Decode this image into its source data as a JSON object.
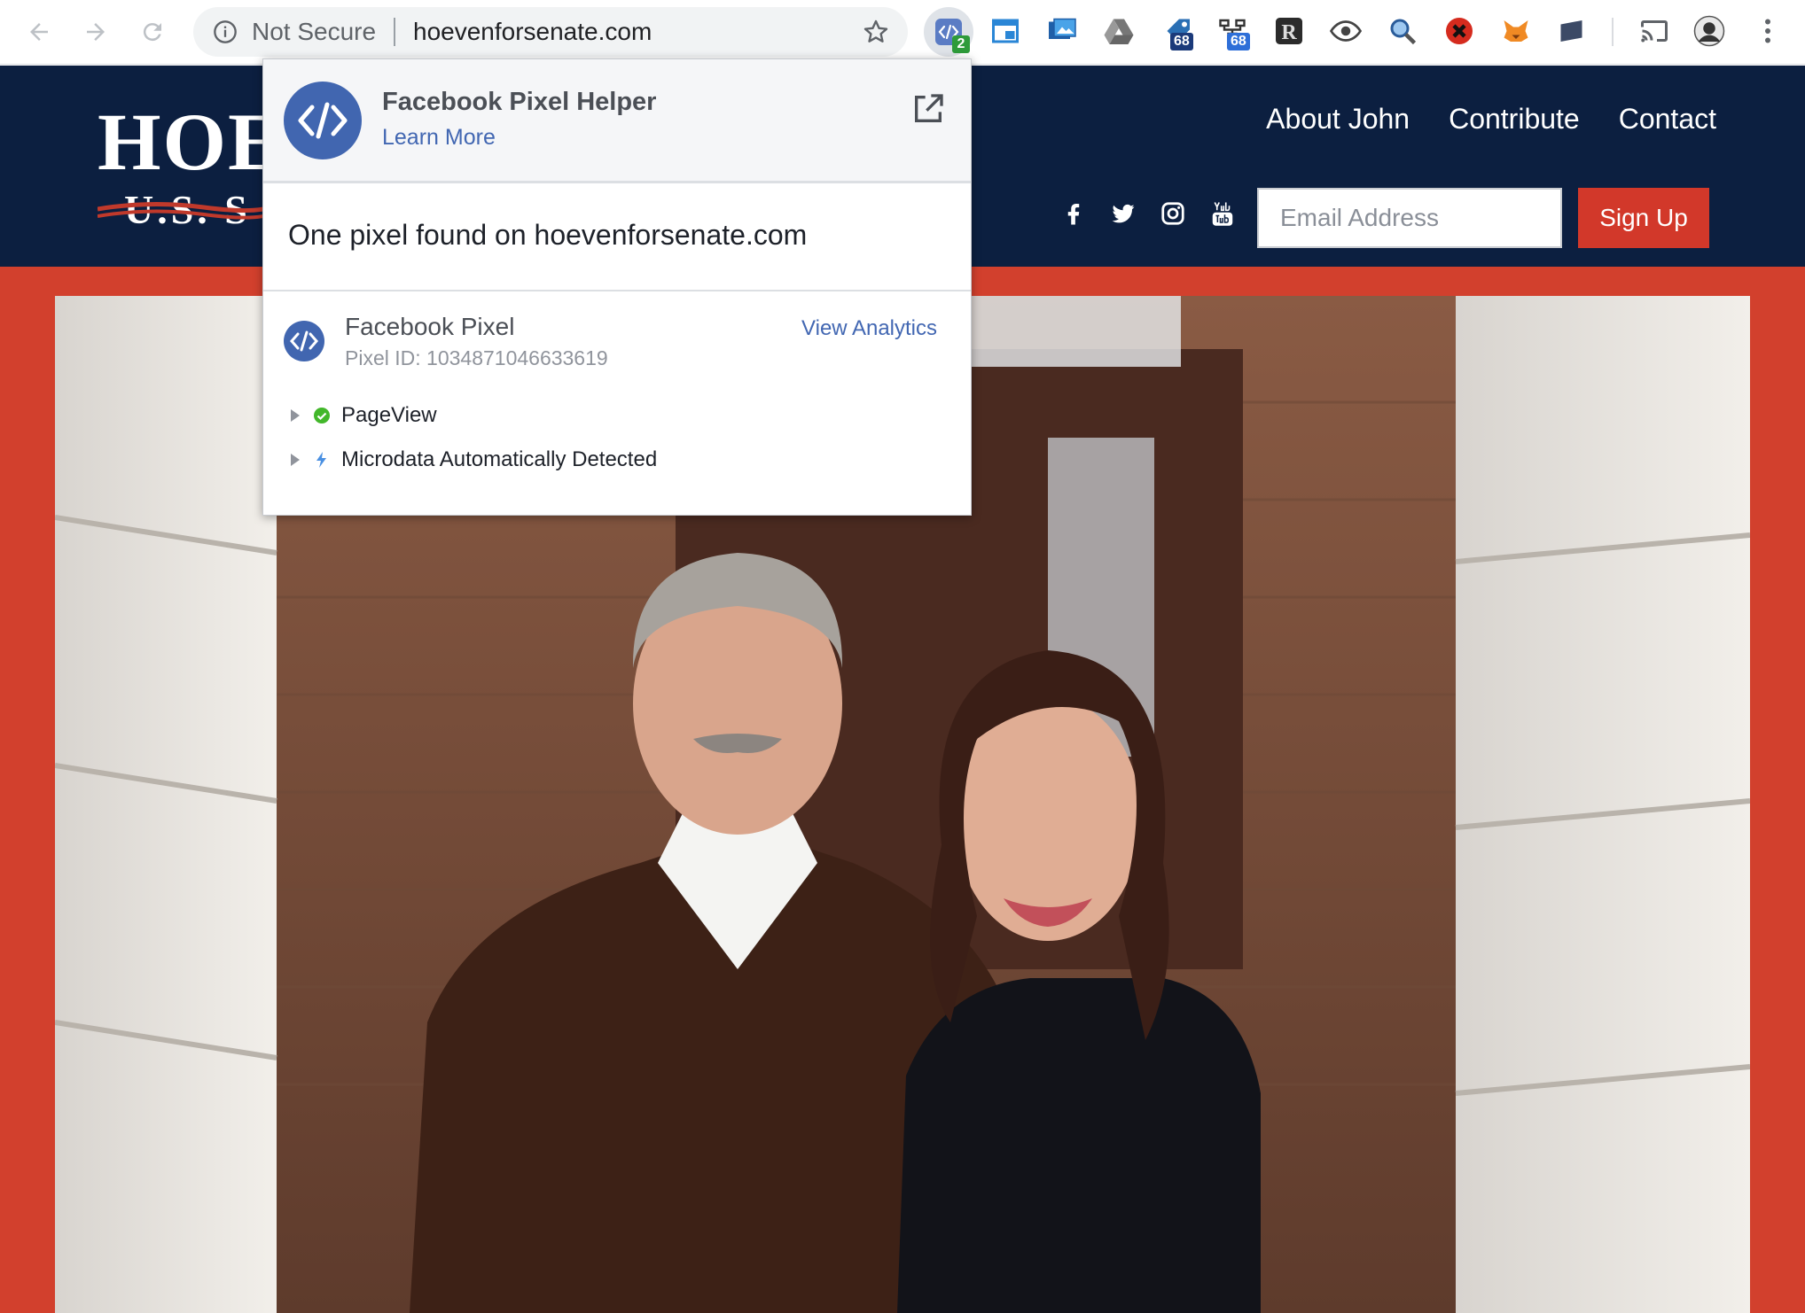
{
  "browser": {
    "security_label": "Not Secure",
    "url": "hoevenforsenate.com",
    "extension_badges": {
      "pixel_helper": "2",
      "extension_a": "68",
      "extension_b": "68"
    }
  },
  "site": {
    "logo_main": "HOE",
    "logo_sub": "U.S. S",
    "nav": [
      "About John",
      "Contribute",
      "Contact"
    ],
    "email_placeholder": "Email Address",
    "signup_label": "Sign Up",
    "colors": {
      "header": "#0c1f40",
      "accent": "#d2382a"
    }
  },
  "popup": {
    "title": "Facebook Pixel Helper",
    "learn_more": "Learn More",
    "summary": "One pixel found on hoevenforsenate.com",
    "pixel": {
      "name": "Facebook Pixel",
      "id_line": "Pixel ID: 1034871046633619",
      "view_analytics": "View Analytics",
      "events": [
        {
          "label": "PageView",
          "icon": "check-circle-icon",
          "color": "#42b72a"
        },
        {
          "label": "Microdata Automatically Detected",
          "icon": "lightning-icon",
          "color": "#4a90e2"
        }
      ]
    }
  }
}
